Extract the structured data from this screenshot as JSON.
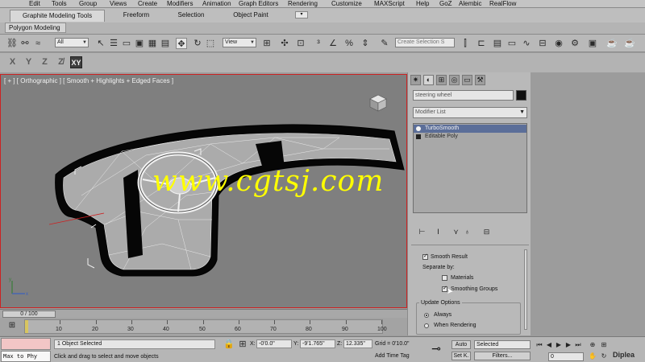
{
  "menubar": {
    "items": [
      "Edit",
      "Tools",
      "Group",
      "Views",
      "Create",
      "Modifiers",
      "Animation",
      "Graph Editors",
      "Rendering",
      "Customize",
      "MAXScript",
      "Help",
      "GoZ",
      "Alembic",
      "RealFlow"
    ]
  },
  "ribbon": {
    "tabs": [
      "Graphite Modeling Tools",
      "Freeform",
      "Selection",
      "Object Paint"
    ],
    "subtab": "Polygon Modeling"
  },
  "toolbar": {
    "filter_value": "All",
    "refcoord_value": "View",
    "create_selection_placeholder": "Create Selection S"
  },
  "axis_constraints": [
    "X",
    "Y",
    "Z",
    "XY"
  ],
  "viewport": {
    "label": "[ + ] [ Orthographic ] [ Smooth + Highlights + Edged Faces ]",
    "watermark": "www.cgtsj.com"
  },
  "command_panel": {
    "object_name": "steering wheel",
    "object_color": "#111111",
    "modifier_list_label": "Modifier List",
    "stack": [
      {
        "label": "TurboSmooth",
        "selected": true
      },
      {
        "label": "Editable Poly",
        "selected": false
      }
    ],
    "rollout": {
      "smooth_result": "Smooth Result",
      "separate_by": "Separate by:",
      "materials": "Materials",
      "smoothing_groups": "Smoothing Groups",
      "update_options": "Update Options",
      "always": "Always",
      "when_rendering": "When Rendering"
    }
  },
  "timeline": {
    "frame_display": "0 / 100",
    "ticks": [
      "10",
      "20",
      "30",
      "40",
      "50",
      "60",
      "70",
      "80",
      "90",
      "100"
    ]
  },
  "status": {
    "maxscript_text": "Max to Phy",
    "selection": "1 Object Selected",
    "prompt": "Click and drag to select and move objects",
    "x_label": "X:",
    "x_value": "-0'0.0\"",
    "y_label": "Y:",
    "y_value": "-9'1.765\"",
    "z_label": "Z:",
    "z_value": "12.335\"",
    "grid": "Grid = 0'10.0\"",
    "add_time_tag": "Add Time Tag",
    "auto_label": "Auto",
    "setk_label": "Set K.",
    "selected_dropdown": "Selected",
    "filters_label": "Filters...",
    "frame_field": "0",
    "logo": "Diplea"
  }
}
